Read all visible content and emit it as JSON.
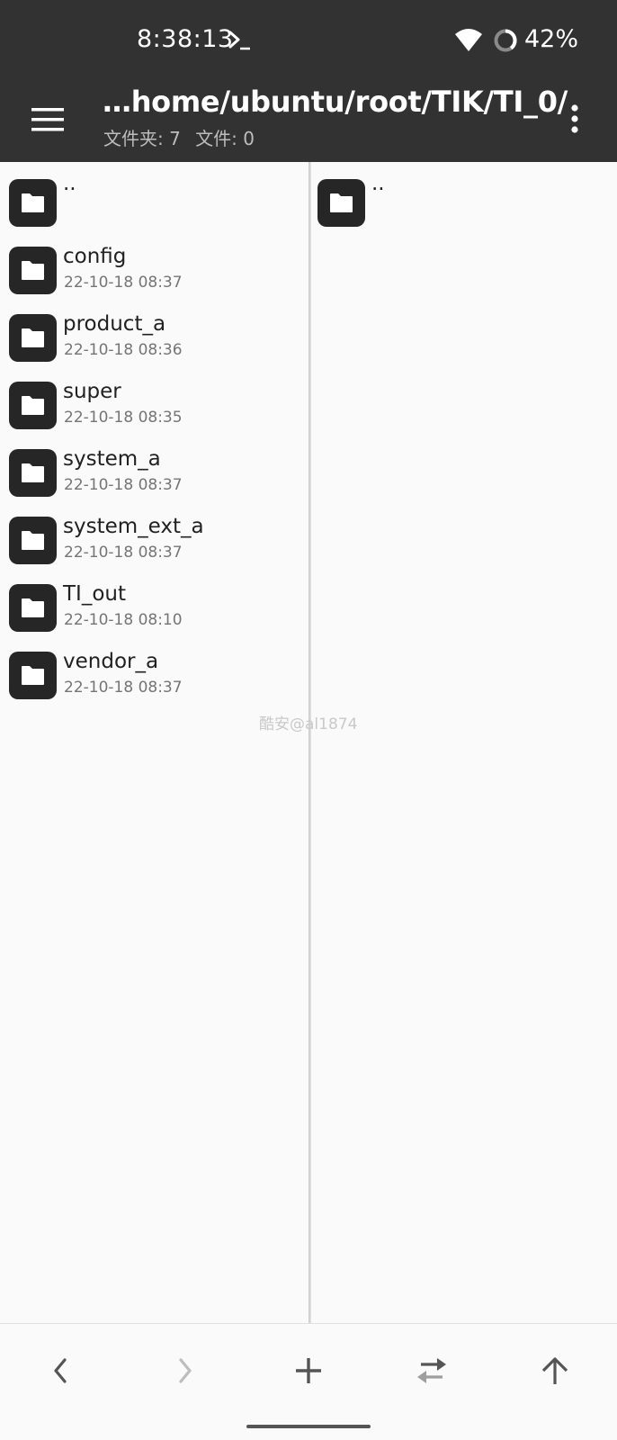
{
  "status_bar": {
    "time": "8:38:13",
    "terminal_icon": "terminal-icon",
    "wifi_icon": "wifi-icon",
    "battery_icon": "battery-icon",
    "battery_percent": "42%"
  },
  "app_bar": {
    "menu_icon": "hamburger-menu-icon",
    "path": "…home/ubuntu/root/TIK/TI_0/",
    "folders_count": "文件夹: 7",
    "files_count": "文件: 0",
    "more_icon": "more-vert-icon"
  },
  "left_pane": {
    "items": [
      {
        "name": "..",
        "date": ""
      },
      {
        "name": "config",
        "date": "22-10-18 08:37"
      },
      {
        "name": "product_a",
        "date": "22-10-18 08:36"
      },
      {
        "name": "super",
        "date": "22-10-18 08:35"
      },
      {
        "name": "system_a",
        "date": "22-10-18 08:37"
      },
      {
        "name": "system_ext_a",
        "date": "22-10-18 08:37"
      },
      {
        "name": "TI_out",
        "date": "22-10-18 08:10"
      },
      {
        "name": "vendor_a",
        "date": "22-10-18 08:37"
      }
    ]
  },
  "right_pane": {
    "items": [
      {
        "name": "..",
        "date": ""
      }
    ]
  },
  "watermark": "酷安@al1874",
  "bottom_bar": {
    "back_icon": "chevron-left-icon",
    "forward_icon": "chevron-right-icon",
    "add_icon": "plus-icon",
    "swap_icon": "swap-arrows-icon",
    "up_icon": "arrow-up-icon"
  },
  "colors": {
    "bar_background": "#323232",
    "page_background": "#fafafa",
    "folder_icon": "#262626"
  }
}
